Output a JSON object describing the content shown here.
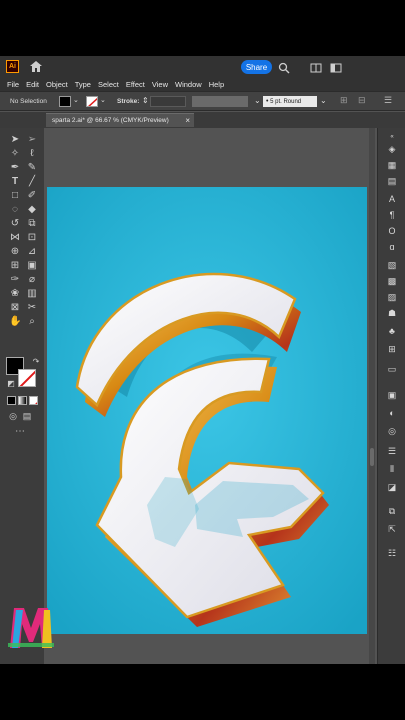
{
  "app": {
    "logo_text": "Ai",
    "share_label": "Share"
  },
  "menu": [
    "File",
    "Edit",
    "Object",
    "Type",
    "Select",
    "Effect",
    "View",
    "Window",
    "Help"
  ],
  "control_bar": {
    "selection_label": "No Selection",
    "stroke_label": "Stroke:",
    "brush_label": "5 pt. Round"
  },
  "document_tab": {
    "title": "sparta 2.ai* @ 66.67 % (CMYK/Preview)",
    "close": "×"
  },
  "colors": {
    "canvas_bg": "#26b1d3",
    "ui_bg": "#535353",
    "panel_bg": "#3c3c3c",
    "accent": "#1473e6"
  },
  "icons": {
    "titlebar": [
      "home-icon",
      "search-icon",
      "arrange-icon",
      "workspace-icon"
    ],
    "tools": [
      "selection-tool",
      "direct-selection-tool",
      "magic-wand-tool",
      "lasso-tool",
      "pen-tool",
      "curvature-tool",
      "type-tool",
      "line-tool",
      "rectangle-tool",
      "paintbrush-tool",
      "shaper-tool",
      "eraser-tool",
      "rotate-tool",
      "scale-tool",
      "width-tool",
      "free-transform-tool",
      "shape-builder-tool",
      "perspective-tool",
      "mesh-tool",
      "gradient-tool",
      "eyedropper-tool",
      "blend-tool",
      "symbol-sprayer-tool",
      "column-graph-tool",
      "artboard-tool",
      "slice-tool",
      "hand-tool",
      "zoom-tool"
    ]
  }
}
